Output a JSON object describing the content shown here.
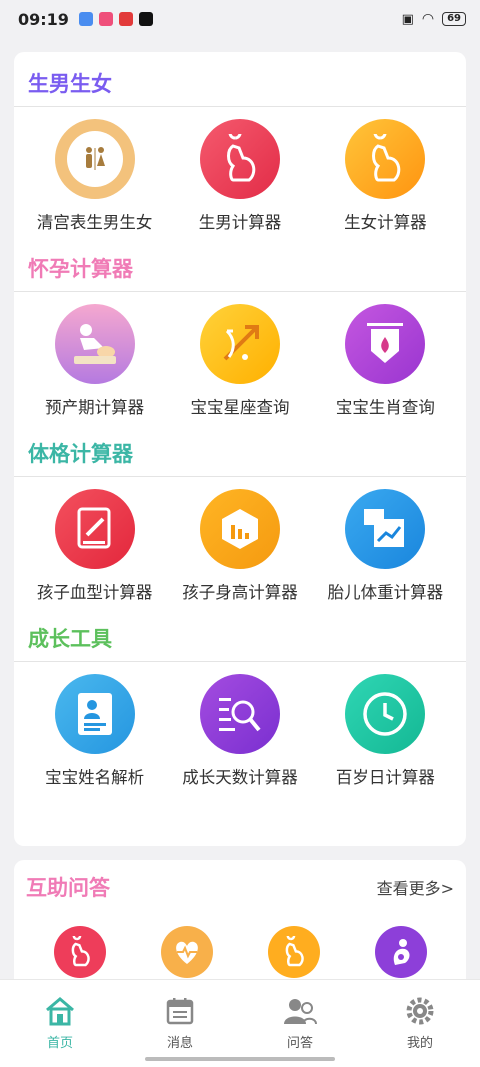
{
  "status_bar": {
    "time": "09:19",
    "battery": "69"
  },
  "sections": [
    {
      "title": "生男生女",
      "color": "#7a5cf0",
      "items": [
        {
          "label": "清宫表生男生女",
          "icon": "toilet-sign-icon",
          "bg": "#f3c27c"
        },
        {
          "label": "生男计算器",
          "icon": "pregnant-icon",
          "bg": "#ee3d5a"
        },
        {
          "label": "生女计算器",
          "icon": "pregnant-icon",
          "bg": "#ffad1f"
        }
      ]
    },
    {
      "title": "怀孕计算器",
      "color": "#f07bb6",
      "items": [
        {
          "label": "预产期计算器",
          "icon": "baby-care-icon",
          "bg": "#e08fd8"
        },
        {
          "label": "宝宝星座查询",
          "icon": "zodiac-icon",
          "bg": "#ffc21a"
        },
        {
          "label": "宝宝生肖查询",
          "icon": "shield-fire-icon",
          "bg": "#b04bd9"
        }
      ]
    },
    {
      "title": "体格计算器",
      "color": "#3bb6a5",
      "items": [
        {
          "label": "孩子血型计算器",
          "icon": "edit-book-icon",
          "bg": "#ee3d4c"
        },
        {
          "label": "孩子身高计算器",
          "icon": "height-chart-icon",
          "bg": "#f8a61c"
        },
        {
          "label": "胎儿体重计算器",
          "icon": "image-icon",
          "bg": "#2a9be8"
        }
      ]
    },
    {
      "title": "成长工具",
      "color": "#5cc05c",
      "items": [
        {
          "label": "宝宝姓名解析",
          "icon": "id-document-icon",
          "bg": "#35a8e8"
        },
        {
          "label": "成长天数计算器",
          "icon": "search-list-icon",
          "bg": "#8d3fd9"
        },
        {
          "label": "百岁日计算器",
          "icon": "clock-icon",
          "bg": "#1fc9a6"
        }
      ]
    }
  ],
  "qa": {
    "title": "互助问答",
    "more": "查看更多>",
    "icons": [
      {
        "icon": "pregnant-icon",
        "bg": "#ee3d5a"
      },
      {
        "icon": "heart-pulse-icon",
        "bg": "#f8b04a"
      },
      {
        "icon": "pregnant-icon",
        "bg": "#ffad1f"
      },
      {
        "icon": "mother-baby-icon",
        "bg": "#8d3fd9"
      }
    ]
  },
  "tabs": [
    {
      "label": "首页",
      "icon": "home-icon",
      "active": true
    },
    {
      "label": "消息",
      "icon": "calendar-icon",
      "active": false
    },
    {
      "label": "问答",
      "icon": "users-icon",
      "active": false
    },
    {
      "label": "我的",
      "icon": "gear-icon",
      "active": false
    }
  ]
}
